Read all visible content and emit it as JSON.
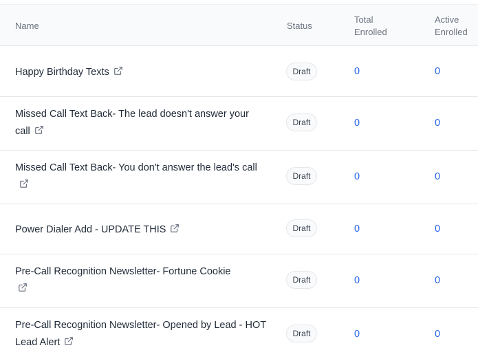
{
  "columns": {
    "name": "Name",
    "status": "Status",
    "total_line1": "Total",
    "total_line2": "Enrolled",
    "active_line1": "Active",
    "active_line2": "Enrolled"
  },
  "icons": {
    "external_link": "external-link-icon"
  },
  "colors": {
    "link_number": "#2563eb",
    "header_bg": "#f9fafb",
    "border": "#e5e7eb"
  },
  "rows": [
    {
      "name": "Happy Birthday Texts",
      "status": "Draft",
      "total": "0",
      "active": "0"
    },
    {
      "name": "Missed Call Text Back- The lead doesn't answer your call",
      "status": "Draft",
      "total": "0",
      "active": "0"
    },
    {
      "name": "Missed Call Text Back- You don't answer the lead's call",
      "status": "Draft",
      "total": "0",
      "active": "0"
    },
    {
      "name": "Power Dialer Add - UPDATE THIS",
      "status": "Draft",
      "total": "0",
      "active": "0"
    },
    {
      "name": "Pre-Call Recognition Newsletter- Fortune Cookie",
      "status": "Draft",
      "total": "0",
      "active": "0"
    },
    {
      "name": "Pre-Call Recognition Newsletter- Opened by Lead - HOT Lead Alert",
      "status": "Draft",
      "total": "0",
      "active": "0"
    }
  ]
}
